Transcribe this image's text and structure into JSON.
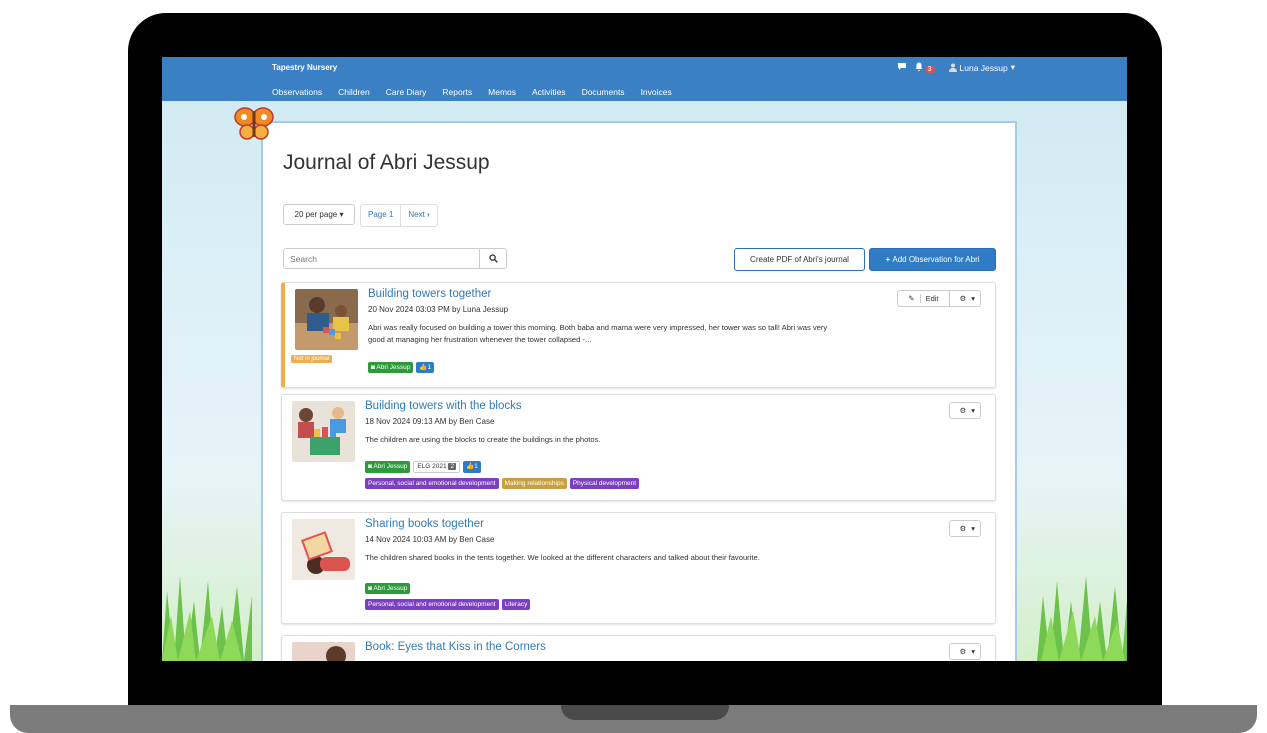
{
  "app": {
    "brand": "Tapestry Nursery"
  },
  "nav": {
    "items": [
      "Observations",
      "Children",
      "Care Diary",
      "Reports",
      "Memos",
      "Activities",
      "Documents",
      "Invoices"
    ],
    "notification_count": "3",
    "user_name": "Luna Jessup",
    "user_caret": "▾"
  },
  "icons": {
    "chat": "chat-icon",
    "bell": "bell-icon",
    "user": "user-icon",
    "search": "search-icon",
    "gear": "gear-icon",
    "pencil": "pencil-icon",
    "thumbs-up": "thumbs-up-icon"
  },
  "colors": {
    "nav": "#3b7fc4",
    "link": "#337ab7",
    "primary": "#2f7bc6",
    "child_tag": "#2e9a3b",
    "framework_tag": "#7b3fc0",
    "gold_tag": "#c8a040",
    "not_in_journal": "#f0ad4e"
  },
  "page": {
    "title": "Journal of Abri Jessup",
    "per_page": "20 per page",
    "page_label": "Page 1",
    "next_label": "Next",
    "search_placeholder": "Search",
    "pdf_button": "Create PDF of Abri's journal",
    "add_button": "Add Observation for Abri"
  },
  "observations": [
    {
      "title": "Building towers together",
      "meta": "20 Nov 2024 03:03 PM by Luna Jessup",
      "body": "Abri was really focused on building a tower this morning. Both baba and mama were very impressed, her tower was so tall! Abri was very good at managing her frustration whenever the tower collapsed -...",
      "status": "Not in journal",
      "child_tag": "Abri Jessup",
      "likes": "1",
      "edit_label": "Edit"
    },
    {
      "title": "Building towers with the blocks",
      "meta": "18 Nov 2024 09:13 AM by Ben Case",
      "body": "The children are using the blocks to create the buildings in the photos.",
      "child_tag": "Abri Jessup",
      "elg_label": "ELG 2021",
      "elg_count": "2",
      "likes": "1",
      "areas": [
        "Personal, social and emotional development",
        "Making relationships",
        "Physical development"
      ]
    },
    {
      "title": "Sharing books together",
      "meta": "14 Nov 2024 10:03 AM by Ben Case",
      "body": "The children shared books in the tents together. We looked at the different characters and talked about their favourite.",
      "child_tag": "Abri Jessup",
      "areas": [
        "Personal, social and emotional development",
        "Literacy"
      ]
    },
    {
      "title": "Book: Eyes that Kiss in the Corners"
    }
  ]
}
